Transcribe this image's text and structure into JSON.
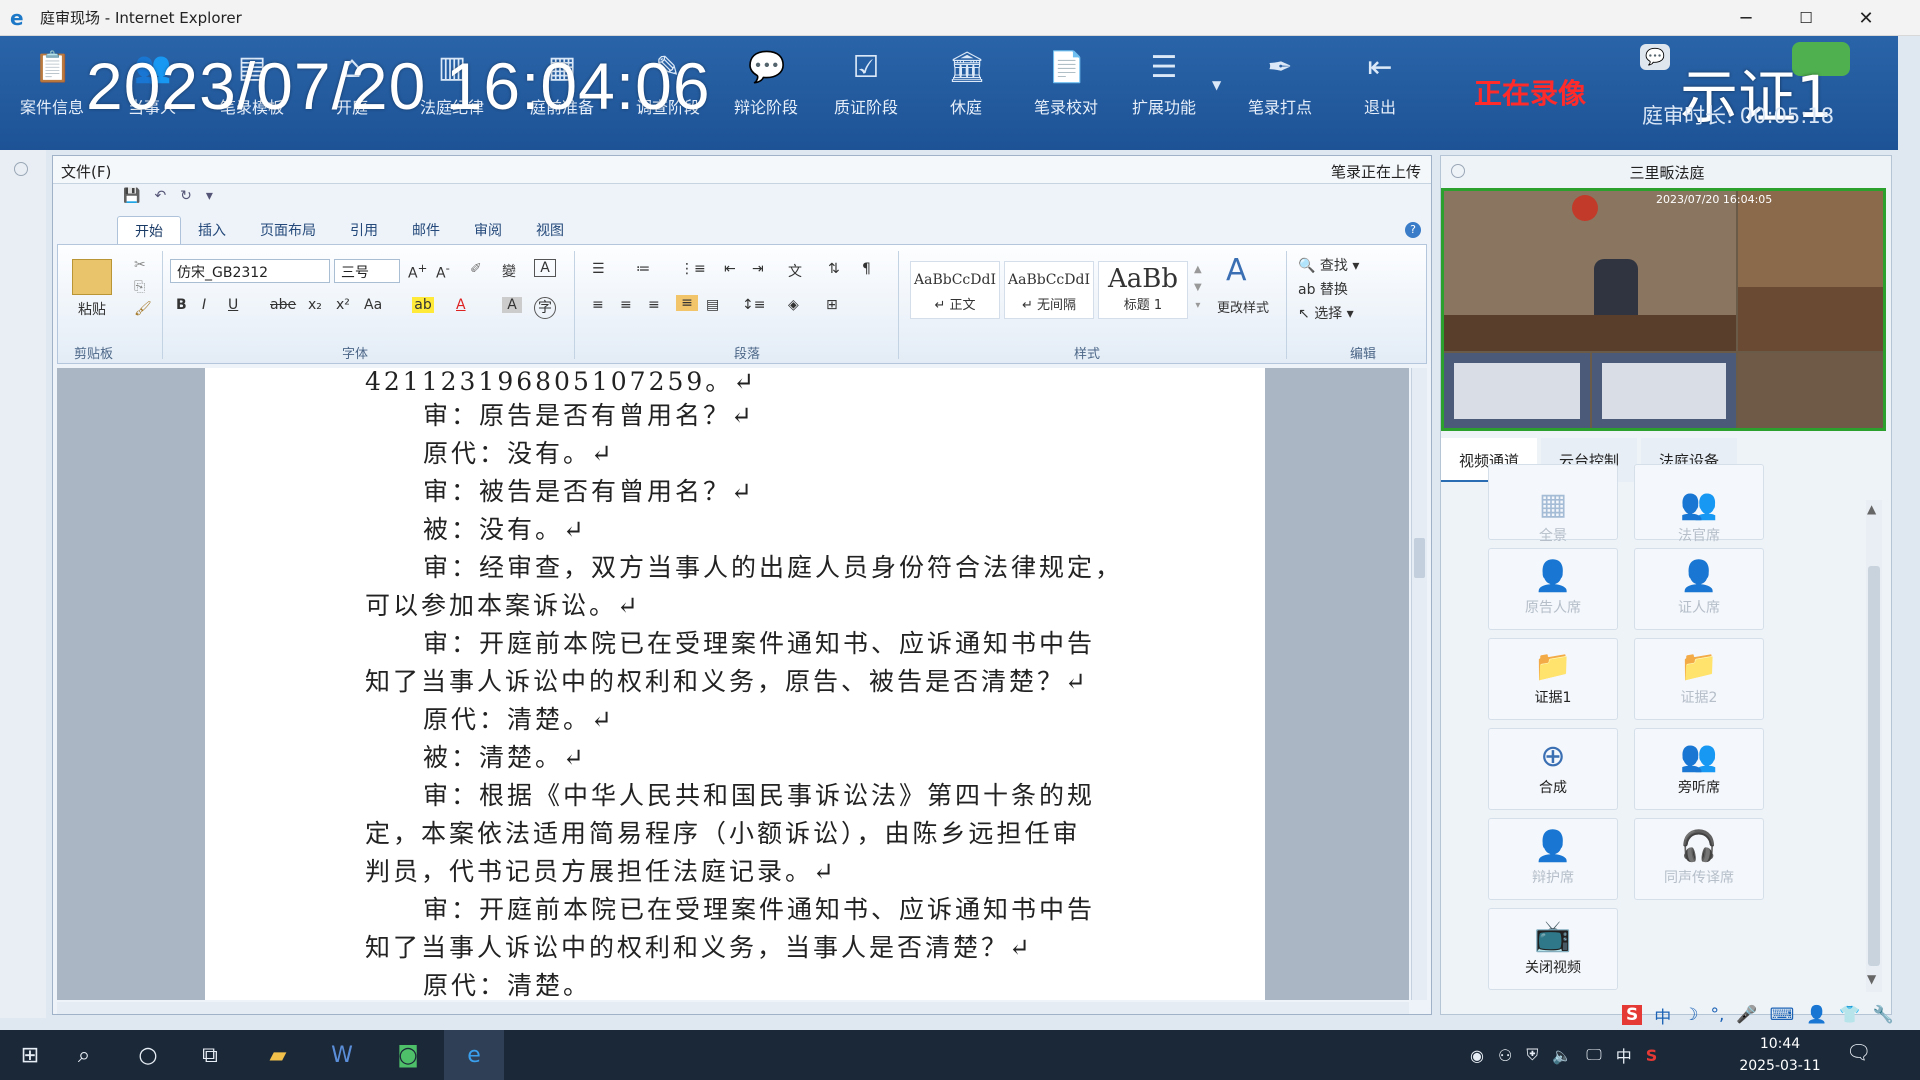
{
  "window": {
    "title": "庭审现场 - Internet Explorer",
    "minimize": "─",
    "maximize": "☐",
    "close": "✕"
  },
  "toolbar": {
    "buttons": [
      {
        "label": "案件信息",
        "icon": "clipboard-icon"
      },
      {
        "label": "当事人",
        "icon": "people-icon"
      },
      {
        "label": "笔录模板",
        "icon": "template-icon"
      },
      {
        "label": "开庭",
        "icon": "court-icon"
      },
      {
        "label": "法庭纪律",
        "icon": "rules-icon"
      },
      {
        "label": "庭前准备",
        "icon": "prepare-icon"
      },
      {
        "label": "调查阶段",
        "icon": "investigate-icon"
      },
      {
        "label": "辩论阶段",
        "icon": "debate-icon"
      },
      {
        "label": "质证阶段",
        "icon": "evidence-icon"
      },
      {
        "label": "休庭",
        "icon": "recess-icon"
      },
      {
        "label": "笔录校对",
        "icon": "proofread-icon"
      },
      {
        "label": "扩展功能",
        "icon": "extend-icon"
      },
      {
        "label": "笔录打点",
        "icon": "mark-icon"
      },
      {
        "label": "退出",
        "icon": "exit-icon"
      }
    ],
    "clock": "2023/07/20 16:04:06",
    "recording": "正在录像",
    "overlay_name": "示证1",
    "duration": "庭审时长: 00:05:18"
  },
  "word": {
    "file_menu": "文件(F)",
    "upload_status": "笔录正在上传",
    "tabs": [
      "开始",
      "插入",
      "页面布局",
      "引用",
      "邮件",
      "审阅",
      "视图"
    ],
    "font_name": "仿宋_GB2312",
    "font_size": "三号",
    "styles": [
      {
        "preview": "AaBbCcDdI",
        "name": "↵ 正文"
      },
      {
        "preview": "AaBbCcDdI",
        "name": "↵ 无间隔"
      },
      {
        "preview": "AaBb",
        "name": "标题 1"
      }
    ],
    "change_styles": "更改样式",
    "find": "查找",
    "replace": "替换",
    "select": "选择",
    "paste": "粘贴",
    "groups": {
      "clipboard": "剪贴板",
      "font": "字体",
      "paragraph": "段落",
      "styles": "样式",
      "editing": "编辑"
    },
    "doc_lines": [
      "421123196805107259。↵",
      "审：原告是否有曾用名？↵",
      "原代：没有。↵",
      "审：被告是否有曾用名？↵",
      "被：没有。↵",
      "审：经审查，双方当事人的出庭人员身份符合法律规定，",
      "可以参加本案诉讼。↵",
      "审：开庭前本院已在受理案件通知书、应诉通知书中告",
      "知了当事人诉讼中的权利和义务，原告、被告是否清楚？↵",
      "原代：清楚。↵",
      "被：清楚。↵",
      "审：根据《中华人民共和国民事诉讼法》第四十条的规",
      "定，本案依法适用简易程序（小额诉讼），由陈乡远担任审",
      "判员，代书记员方展担任法庭记录。↵",
      "审：开庭前本院已在受理案件通知书、应诉通知书中告",
      "知了当事人诉讼中的权利和义务，当事人是否清楚？↵",
      "原代：清楚。"
    ]
  },
  "right_panel": {
    "court_name": "三里畈法庭",
    "video_timestamp": "2023/07/20 16:04:05",
    "tabs": [
      "视频通道",
      "云台控制",
      "法庭设备"
    ],
    "tiles": [
      {
        "label": "全景",
        "icon": "panorama-icon",
        "dim": true
      },
      {
        "label": "法官席",
        "icon": "judge-icon",
        "dim": true
      },
      {
        "label": "原告人席",
        "icon": "plaintiff-icon",
        "dim": true
      },
      {
        "label": "证人席",
        "icon": "witness-icon",
        "dim": true
      },
      {
        "label": "证据1",
        "icon": "folder-1-icon",
        "dim": false
      },
      {
        "label": "证据2",
        "icon": "folder-2-icon",
        "dim": true
      },
      {
        "label": "合成",
        "icon": "composite-icon",
        "dim": false
      },
      {
        "label": "旁听席",
        "icon": "audience-icon",
        "dim": false
      },
      {
        "label": "辩护席",
        "icon": "defense-icon",
        "dim": true
      },
      {
        "label": "同声传译席",
        "icon": "interpreter-icon",
        "dim": true
      },
      {
        "label": "关闭视频",
        "icon": "close-video-icon",
        "dim": false
      }
    ]
  },
  "ime": [
    "中",
    "☽",
    "°,",
    "🎤",
    "⌨",
    "👤",
    "👕",
    "🔧"
  ],
  "taskbar": {
    "time": "10:44",
    "date": "2025-03-11",
    "ime_lang": "中"
  },
  "colors": {
    "toolbar": "#1d5396",
    "recording": "#ff2a2a",
    "video_border": "#2ca02c"
  }
}
